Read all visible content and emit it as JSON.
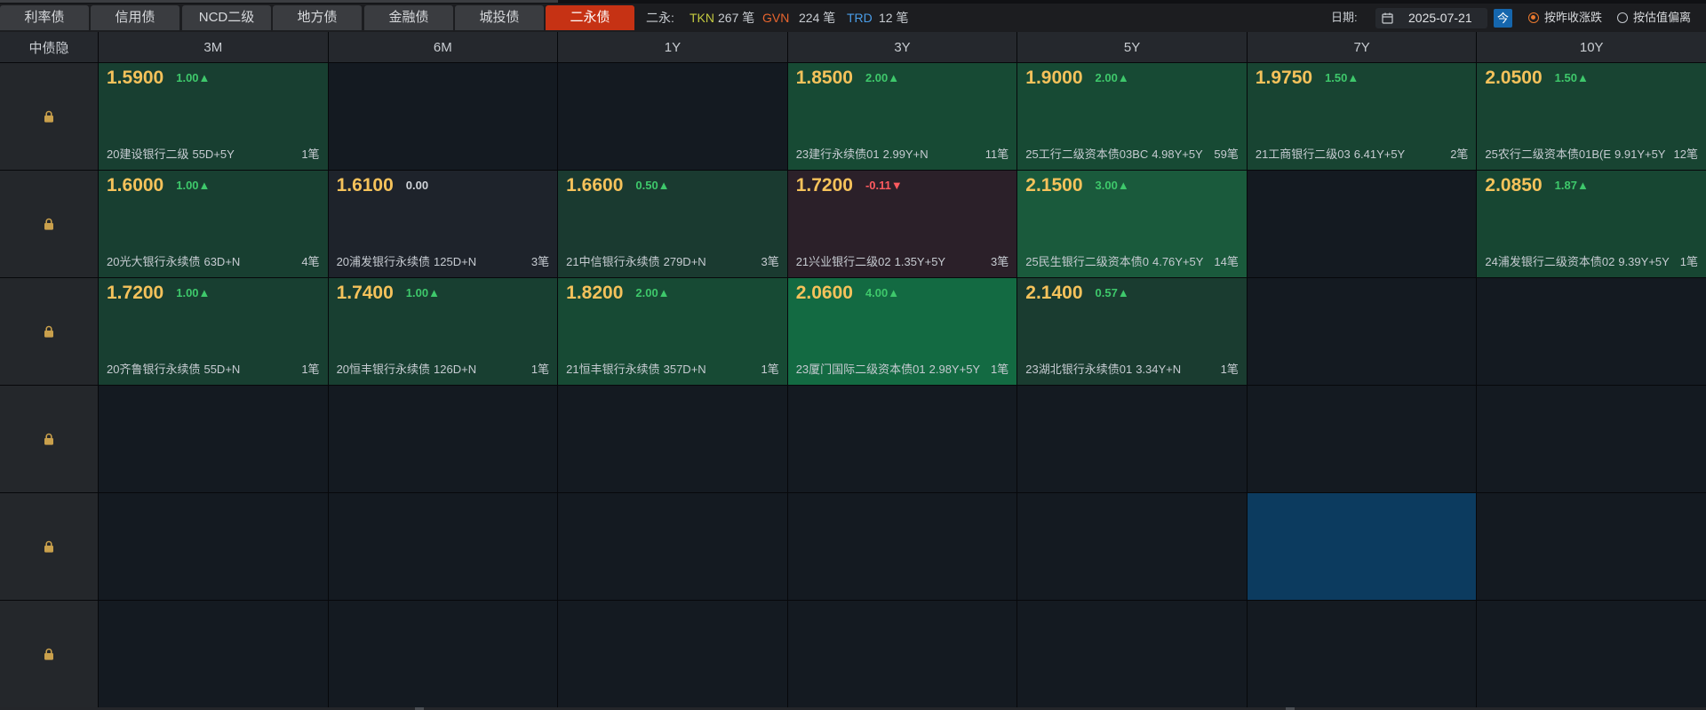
{
  "tabs": [
    {
      "label": "利率债",
      "active": false
    },
    {
      "label": "信用债",
      "active": false
    },
    {
      "label": "NCD二级",
      "active": false
    },
    {
      "label": "地方债",
      "active": false
    },
    {
      "label": "金融债",
      "active": false
    },
    {
      "label": "城投债",
      "active": false
    },
    {
      "label": "二永债",
      "active": true
    }
  ],
  "summary": {
    "label": "二永:",
    "items": [
      {
        "code": "TKN",
        "count": "267 笔",
        "color": "#c3c940"
      },
      {
        "code": "GVN",
        "count": "224 笔",
        "color": "#e8652e"
      },
      {
        "code": "TRD",
        "count": "12 笔",
        "color": "#4a9de8"
      }
    ]
  },
  "date_picker": {
    "label": "日期:",
    "value": "2025-07-21",
    "today_button": "今",
    "icon": "calendar-icon"
  },
  "mode": {
    "options": [
      {
        "label": "按昨收涨跌",
        "checked": true
      },
      {
        "label": "按估值偏离",
        "checked": false
      }
    ]
  },
  "grid": {
    "corner_label": "中债隐",
    "row_icon": "lock-icon",
    "columns": [
      "3M",
      "6M",
      "1Y",
      "3Y",
      "5Y",
      "7Y",
      "10Y"
    ],
    "rows": [
      {
        "cells": [
          {
            "value": "1.5900",
            "change": "1.00▲",
            "trend": "up",
            "name": "20建设银行二级",
            "term": "55D+5Y",
            "count": "1笔",
            "bg": "#183f31"
          },
          {},
          {},
          {
            "value": "1.8500",
            "change": "2.00▲",
            "trend": "up",
            "name": "23建行永续债01",
            "term": "2.99Y+N",
            "count": "11笔",
            "bg": "#174a34"
          },
          {
            "value": "1.9000",
            "change": "2.00▲",
            "trend": "up",
            "name": "25工行二级资本债03BC",
            "term": "4.98Y+5Y",
            "count": "59笔",
            "bg": "#174a34"
          },
          {
            "value": "1.9750",
            "change": "1.50▲",
            "trend": "up",
            "name": "21工商银行二级03",
            "term": "6.41Y+5Y",
            "count": "2笔",
            "bg": "#184432"
          },
          {
            "value": "2.0500",
            "change": "1.50▲",
            "trend": "up",
            "name": "25农行二级资本债01B(E",
            "term": "9.91Y+5Y",
            "count": "12笔",
            "bg": "#184432"
          }
        ]
      },
      {
        "cells": [
          {
            "value": "1.6000",
            "change": "1.00▲",
            "trend": "up",
            "name": "20光大银行永续债",
            "term": "63D+N",
            "count": "4笔",
            "bg": "#183f31"
          },
          {
            "value": "1.6100",
            "change": "0.00",
            "trend": "flat",
            "name": "20浦发银行永续债",
            "term": "125D+N",
            "count": "3笔",
            "bg": "#1e232b"
          },
          {
            "value": "1.6600",
            "change": "0.50▲",
            "trend": "up",
            "name": "21中信银行永续债",
            "term": "279D+N",
            "count": "3笔",
            "bg": "#1a3a30"
          },
          {
            "value": "1.7200",
            "change": "-0.11▼",
            "trend": "down",
            "name": "21兴业银行二级02",
            "term": "1.35Y+5Y",
            "count": "3笔",
            "bg": "#2b2029"
          },
          {
            "value": "2.1500",
            "change": "3.00▲",
            "trend": "up",
            "name": "25民生银行二级资本债0",
            "term": "4.76Y+5Y",
            "count": "14笔",
            "bg": "#1a5a3c"
          },
          {},
          {
            "value": "2.0850",
            "change": "1.87▲",
            "trend": "up",
            "name": "24浦发银行二级资本债02",
            "term": "9.39Y+5Y",
            "count": "1笔",
            "bg": "#174632"
          }
        ]
      },
      {
        "cells": [
          {
            "value": "1.7200",
            "change": "1.00▲",
            "trend": "up",
            "name": "20齐鲁银行永续债",
            "term": "55D+N",
            "count": "1笔",
            "bg": "#183f31"
          },
          {
            "value": "1.7400",
            "change": "1.00▲",
            "trend": "up",
            "name": "20恒丰银行永续债",
            "term": "126D+N",
            "count": "1笔",
            "bg": "#183f31"
          },
          {
            "value": "1.8200",
            "change": "2.00▲",
            "trend": "up",
            "name": "21恒丰银行永续债",
            "term": "357D+N",
            "count": "1笔",
            "bg": "#174a34"
          },
          {
            "value": "2.0600",
            "change": "4.00▲",
            "trend": "up",
            "name": "23厦门国际二级资本债01",
            "term": "2.98Y+5Y",
            "count": "1笔",
            "bg": "#136a42"
          },
          {
            "value": "2.1400",
            "change": "0.57▲",
            "trend": "up",
            "name": "23湖北银行永续债01",
            "term": "3.34Y+N",
            "count": "1笔",
            "bg": "#1a3c30"
          },
          {},
          {}
        ]
      },
      {
        "cells": [
          {},
          {},
          {},
          {},
          {},
          {},
          {}
        ]
      },
      {
        "cells": [
          {},
          {},
          {},
          {},
          {},
          {
            "selected": true
          },
          {}
        ]
      },
      {
        "cells": [
          {},
          {},
          {},
          {},
          {},
          {},
          {}
        ]
      }
    ]
  },
  "colors": {
    "tab_active": "#c63214",
    "today_button": "#1566ad",
    "radio_checked": "#e8782e",
    "value": "#f5c25b",
    "trend_up": "#3ec86b",
    "trend_down": "#ff5a5f",
    "trend_flat": "#cfd3d8",
    "empty_cell": "#141a21",
    "selected_cell": "#0c3b5f",
    "lock": "#c9a04c"
  }
}
